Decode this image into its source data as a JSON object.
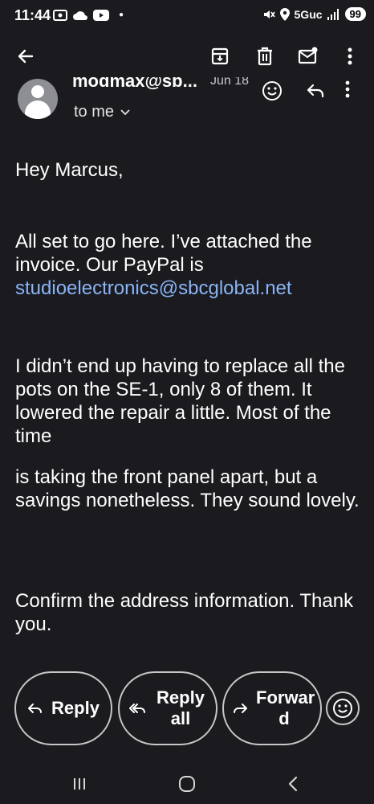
{
  "status_bar": {
    "time": "11:44",
    "network": "5Guc",
    "battery": "99"
  },
  "toolbar": {
    "icons": [
      "back-arrow-icon",
      "archive-icon",
      "trash-icon",
      "mark-unread-icon",
      "more-vert-icon"
    ]
  },
  "message": {
    "sender_name": "modmax@sb...",
    "date": "Jun 18",
    "recipient": "to me",
    "greeting": "Hey Marcus,",
    "paragraph1": "All set to go here. I’ve attached the invoice. Our PayPal is",
    "email_link": "studioelectronics@sbcglobal.net",
    "paragraph2": "I didn’t end up having to replace all the pots on the SE-1, only 8 of them. It lowered the repair a little. Most of the time",
    "paragraph3": "is taking the front panel apart, but a savings nonetheless. They sound lovely.",
    "paragraph4": "Confirm the address information. Thank you."
  },
  "actions": {
    "reply": "Reply",
    "reply_all": "Reply all",
    "forward": "Forwar d"
  },
  "colors": {
    "background": "#1b1b1f",
    "link": "#8ab4f8",
    "border": "#c7c7c7"
  }
}
